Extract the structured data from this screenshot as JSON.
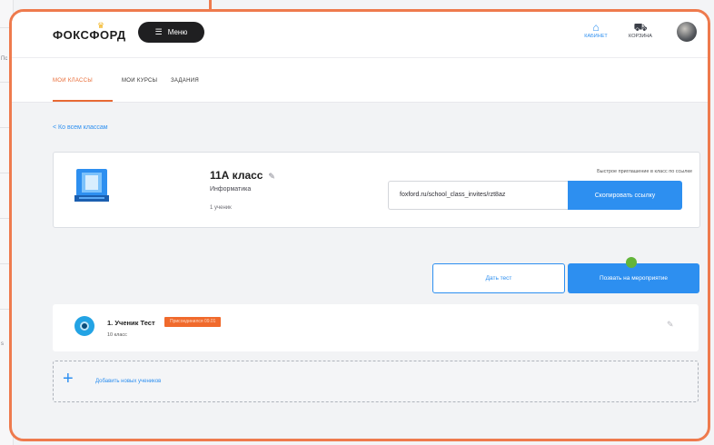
{
  "header": {
    "logo_text": "ФОКСФОРД",
    "menu_label": "Меню",
    "nav": [
      {
        "label": "КАБИНЕТ",
        "icon": "home-icon"
      },
      {
        "label": "КОРЗИНА",
        "icon": "cart-icon"
      }
    ]
  },
  "tabs": [
    "МОИ КЛАССЫ",
    "МОИ КУРСЫ",
    "ЗАДАНИЯ"
  ],
  "back_link": "< Ко всем классам",
  "class_card": {
    "name": "11А класс",
    "subject": "Информатика",
    "student_count": "1 ученик",
    "invite_label": "Быстрое приглашение в класс по ссылке",
    "invite_link": "foxford.ru/school_class_invites/rzt8az",
    "copy_button": "Скопировать ссылку"
  },
  "actions": {
    "give_test": "Дать тест",
    "invite_event": "Позвать на мероприятие"
  },
  "student": {
    "name": "1. Ученик Тест",
    "badge": "Присоединился 09.01",
    "class": "10 класс"
  },
  "add_students": "Добавить новых учеников",
  "colors": {
    "accent_blue": "#2d8ff0",
    "accent_orange": "#e86a34",
    "frame_orange": "#ee7a4d"
  }
}
